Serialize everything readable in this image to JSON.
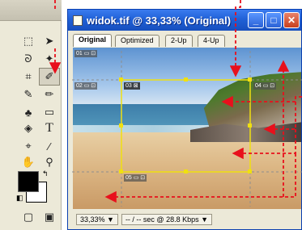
{
  "window": {
    "title": "widok.tif @ 33,33% (Original)",
    "minimize_label": "_",
    "maximize_label": "□",
    "close_label": "✕"
  },
  "tabs": [
    {
      "label": "Original",
      "active": true
    },
    {
      "label": "Optimized",
      "active": false
    },
    {
      "label": "2-Up",
      "active": false
    },
    {
      "label": "4-Up",
      "active": false
    }
  ],
  "slices": [
    "01",
    "02",
    "03",
    "04",
    "05"
  ],
  "status": {
    "zoom": "33,33% ▼",
    "download": "-- / -- sec @ 28.8 Kbps ▼"
  },
  "toolbox": {
    "type_tool_label": "T"
  },
  "colors": {
    "guide_red": "#e8101c",
    "slice_yellow": "#f0e010",
    "titlebar_blue": "#1f5fd4"
  }
}
